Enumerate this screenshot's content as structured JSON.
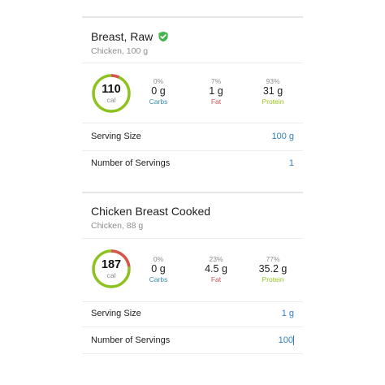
{
  "colors": {
    "carbs": "#3a8db0",
    "fat": "#d25557",
    "protein": "#98c31c",
    "value_blue": "#2f7ec2",
    "ring_red": "#d9534f",
    "ring_green": "#8dc21f"
  },
  "foods": [
    {
      "title": "Breast, Raw",
      "verified": true,
      "verified_icon": "check-shield-icon",
      "subtitle": "Chicken, 100 g",
      "calories": "110",
      "cal_unit": "cal",
      "macros": {
        "carbs": {
          "pct": "0%",
          "amount": "0 g",
          "label": "Carbs"
        },
        "fat": {
          "pct": "7%",
          "amount": "1 g",
          "label": "Fat"
        },
        "protein": {
          "pct": "93%",
          "amount": "31 g",
          "label": "Protein"
        }
      },
      "fat_fraction": 0.07,
      "serving_size_label": "Serving Size",
      "serving_size_value": "100 g",
      "servings_label": "Number of Servings",
      "servings_value": "1"
    },
    {
      "title": "Chicken Breast Cooked",
      "verified": false,
      "subtitle": "Chicken, 88 g",
      "calories": "187",
      "cal_unit": "cal",
      "macros": {
        "carbs": {
          "pct": "0%",
          "amount": "0 g",
          "label": "Carbs"
        },
        "fat": {
          "pct": "23%",
          "amount": "4.5 g",
          "label": "Fat"
        },
        "protein": {
          "pct": "77%",
          "amount": "35.2 g",
          "label": "Protein"
        }
      },
      "fat_fraction": 0.23,
      "serving_size_label": "Serving Size",
      "serving_size_value": "1 g",
      "servings_label": "Number of Servings",
      "servings_value": "100"
    }
  ]
}
